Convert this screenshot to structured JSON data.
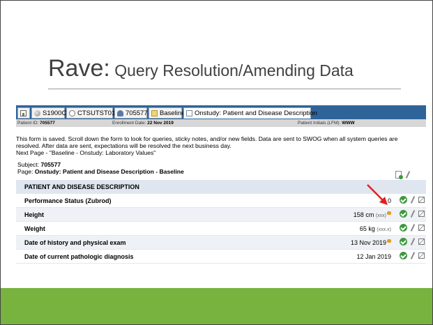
{
  "slide": {
    "title_main": "Rave:",
    "title_sub": " Query Resolution/Amending Data"
  },
  "tabs": [
    {
      "label": "",
      "icon": "home-icon"
    },
    {
      "label": "S1900C",
      "icon": "study-icon"
    },
    {
      "label": "CTSUTST01",
      "icon": "site-icon"
    },
    {
      "label": "705577",
      "icon": "subject-icon"
    },
    {
      "label": "Baseline",
      "icon": "folder-icon"
    },
    {
      "label": "Onstudy: Patient and Disease Description",
      "icon": "form-icon"
    }
  ],
  "info": {
    "patient_id_label": "Patient ID:",
    "patient_id": "705577",
    "enroll_label": "Enrollment Date:",
    "enroll_date": "22 Nov 2019",
    "initials_label": "Patient Initials (LFM):",
    "initials": "WWW"
  },
  "message": {
    "line1": "This form is saved. Scroll down the form to look for queries, sticky notes, and/or new fields. Data are sent to SWOG when all system queries are",
    "line2": "resolved. After data are sent, expectations will be resolved the next business day.",
    "line3": "Next Page - \"Baseline - Onstudy: Laboratory Values\""
  },
  "subject": {
    "subject_label": "Subject:",
    "subject_id": "705577",
    "page_label": "Page:",
    "page_name": "Onstudy: Patient and Disease Description - Baseline"
  },
  "form": {
    "section_title": "PATIENT AND DISEASE DESCRIPTION",
    "fields": [
      {
        "label": "Performance Status (Zubrod)",
        "value": "0",
        "unit": "",
        "format": ""
      },
      {
        "label": "Height",
        "value": "158",
        "unit": "cm",
        "format": "(xxx)"
      },
      {
        "label": "Weight",
        "value": "65",
        "unit": "kg",
        "format": "(xxx.x)"
      },
      {
        "label": "Date of history and physical exam",
        "value": "13 Nov 2019",
        "unit": "",
        "format": ""
      },
      {
        "label": "Date of current pathologic diagnosis",
        "value": "12 Jan 2019",
        "unit": "",
        "format": ""
      }
    ]
  },
  "colors": {
    "tab_bar": "#2f6499",
    "footer_bar": "#78b340",
    "arrow": "#e02020",
    "check": "#3c9a3c"
  }
}
